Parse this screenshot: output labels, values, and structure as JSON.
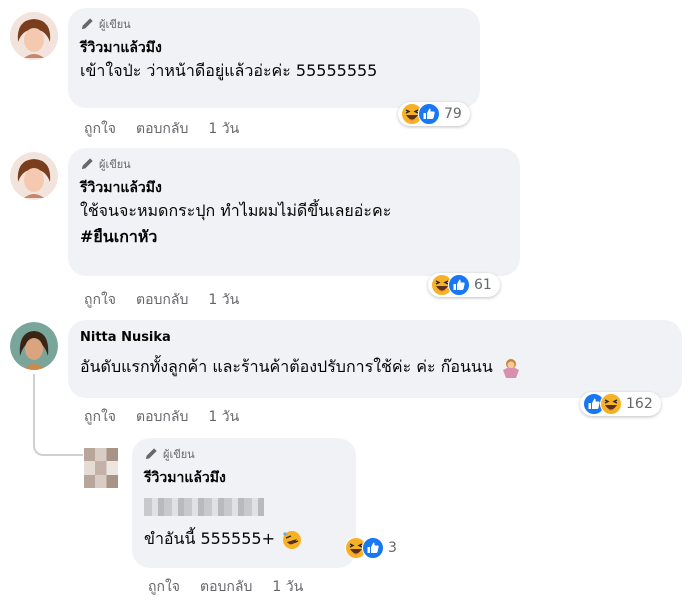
{
  "comments": [
    {
      "author_badge": "ผู้เขียน",
      "name": "รีวิวมาแล้วมึง",
      "lines": [
        "เข้าใจป่ะ ว่าหน้าดีอยู่แล้วอ่ะค่ะ 55555555"
      ],
      "reaction_count": "79",
      "actions": {
        "like": "ถูกใจ",
        "reply": "ตอบกลับ",
        "time": "1 วัน"
      }
    },
    {
      "author_badge": "ผู้เขียน",
      "name": "รีวิวมาแล้วมึง",
      "lines": [
        "ใช้จนจะหมดกระปุก ทำไมผมไม่ดีขึ้นเลยอ่ะคะ",
        "#ยืนเกาหัว"
      ],
      "reaction_count": "61",
      "actions": {
        "like": "ถูกใจ",
        "reply": "ตอบกลับ",
        "time": "1 วัน"
      }
    },
    {
      "name": "Nitta Nusika",
      "lines": [
        "อันดับแรกทั้งลูกค้า และร้านค้าต้องปรับการใช้ค่ะ ค่ะ ก๊อนนน"
      ],
      "reaction_count": "162",
      "actions": {
        "like": "ถูกใจ",
        "reply": "ตอบกลับ",
        "time": "1 วัน"
      }
    },
    {
      "author_badge": "ผู้เขียน",
      "name": "รีวิวมาแล้วมึง",
      "lines": [
        "ขำอันนี้ 555555+"
      ],
      "reaction_count": "3",
      "actions": {
        "like": "ถูกใจ",
        "reply": "ตอบกลับ",
        "time": "1 วัน"
      }
    }
  ],
  "icons": {
    "author_badge": "pencil-icon",
    "reaction_haha": "haha-reaction-icon",
    "reaction_like": "like-reaction-icon",
    "emoji_shrug": "woman-shrugging-emoji",
    "emoji_rofl": "rofl-emoji"
  },
  "colors": {
    "bubble": "#f0f2f5",
    "like_blue": "#1877f2",
    "haha_yellow": "#f7b125",
    "meta_gray": "#65676b"
  }
}
